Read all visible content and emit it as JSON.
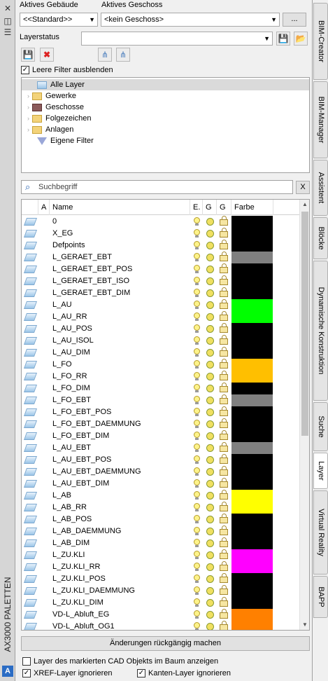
{
  "window": {
    "title": "AX3000 PALETTEN"
  },
  "header": {
    "building_label": "Aktives Gebäude",
    "floor_label": "Aktives Geschoss",
    "building_value": "<<Standard>>",
    "floor_value": "<kein Geschoss>",
    "more_label": "...",
    "layerstatus_label": "Layerstatus",
    "layerstatus_value": ""
  },
  "options": {
    "hide_empty_filters": "Leere Filter ausblenden"
  },
  "tree": {
    "items": [
      {
        "label": "Alle Layer",
        "icon": "layer-stack-icon",
        "selected": true
      },
      {
        "label": "Gewerke",
        "icon": "folder-icon"
      },
      {
        "label": "Geschosse",
        "icon": "floor-icon"
      },
      {
        "label": "Folgezeichen",
        "icon": "folder-icon"
      },
      {
        "label": "Anlagen",
        "icon": "folder-icon"
      },
      {
        "label": "Eigene Filter",
        "icon": "filter-icon"
      }
    ]
  },
  "search": {
    "placeholder": "Suchbegriff",
    "clear_label": "X"
  },
  "grid": {
    "headers": {
      "a": "A",
      "name": "Name",
      "e": "E.",
      "g1": "G",
      "g2": "G",
      "color": "Farbe"
    },
    "rows": [
      {
        "name": "0",
        "color": "#000000"
      },
      {
        "name": "X_EG",
        "color": "#000000"
      },
      {
        "name": "Defpoints",
        "color": "#000000"
      },
      {
        "name": "L_GERAET_EBT",
        "color": "#808080"
      },
      {
        "name": "L_GERAET_EBT_POS",
        "color": "#000000"
      },
      {
        "name": "L_GERAET_EBT_ISO",
        "color": "#000000"
      },
      {
        "name": "L_GERAET_EBT_DIM",
        "color": "#000000"
      },
      {
        "name": "L_AU",
        "color": "#00ff00"
      },
      {
        "name": "L_AU_RR",
        "color": "#00ff00"
      },
      {
        "name": "L_AU_POS",
        "color": "#000000"
      },
      {
        "name": "L_AU_ISOL",
        "color": "#000000"
      },
      {
        "name": "L_AU_DIM",
        "color": "#000000"
      },
      {
        "name": "L_FO",
        "color": "#ffbf00"
      },
      {
        "name": "L_FO_RR",
        "color": "#ffbf00"
      },
      {
        "name": "L_FO_DIM",
        "color": "#000000"
      },
      {
        "name": "L_FO_EBT",
        "color": "#808080"
      },
      {
        "name": "L_FO_EBT_POS",
        "color": "#000000"
      },
      {
        "name": "L_FO_EBT_DAEMMUNG",
        "color": "#000000"
      },
      {
        "name": "L_FO_EBT_DIM",
        "color": "#000000"
      },
      {
        "name": "L_AU_EBT",
        "color": "#808080"
      },
      {
        "name": "L_AU_EBT_POS",
        "color": "#000000"
      },
      {
        "name": "L_AU_EBT_DAEMMUNG",
        "color": "#000000"
      },
      {
        "name": "L_AU_EBT_DIM",
        "color": "#000000"
      },
      {
        "name": "L_AB",
        "color": "#ffff00"
      },
      {
        "name": "L_AB_RR",
        "color": "#ffff00"
      },
      {
        "name": "L_AB_POS",
        "color": "#000000"
      },
      {
        "name": "L_AB_DAEMMUNG",
        "color": "#000000"
      },
      {
        "name": "L_AB_DIM",
        "color": "#000000"
      },
      {
        "name": "L_ZU.KLI",
        "color": "#ff00ff"
      },
      {
        "name": "L_ZU.KLI_RR",
        "color": "#ff00ff"
      },
      {
        "name": "L_ZU.KLI_POS",
        "color": "#000000"
      },
      {
        "name": "L_ZU.KLI_DAEMMUNG",
        "color": "#000000"
      },
      {
        "name": "L_ZU.KLI_DIM",
        "color": "#000000"
      },
      {
        "name": "VD-L_Abluft_EG",
        "color": "#ff8000"
      },
      {
        "name": "VD-L_Abluft_OG1",
        "color": "#ff8000"
      }
    ]
  },
  "footer": {
    "undo_label": "Änderungen rückgängig machen",
    "show_marked": "Layer des markierten CAD Objekts im Baum anzeigen",
    "ignore_xref": "XREF-Layer ignorieren",
    "ignore_edge": "Kanten-Layer ignorieren"
  },
  "tabs": [
    {
      "label": "BIM-Creator"
    },
    {
      "label": "BIM-Manager"
    },
    {
      "label": "Assistent"
    },
    {
      "label": "Blöcke"
    },
    {
      "label": "Dynamische Konstruktion"
    },
    {
      "label": "Suche"
    },
    {
      "label": "Layer",
      "active": true
    },
    {
      "label": "Virtual Reality"
    },
    {
      "label": "BAPP"
    }
  ]
}
